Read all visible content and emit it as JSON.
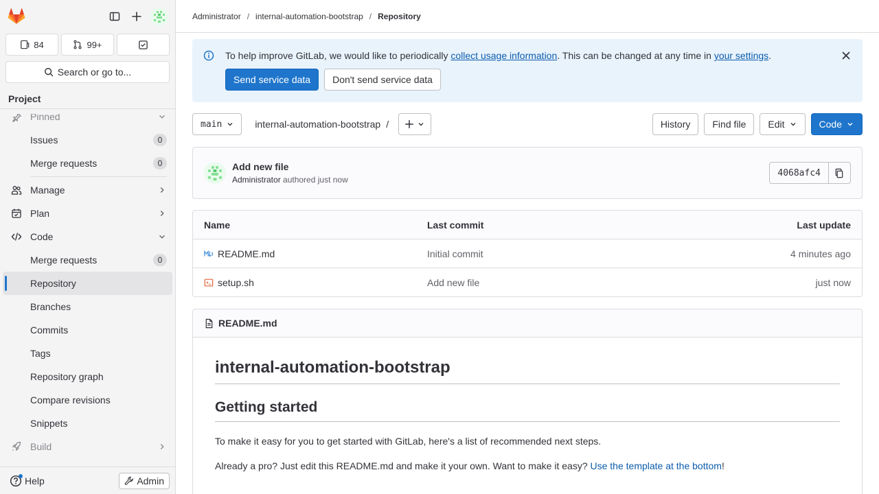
{
  "sidebar": {
    "counts": {
      "issues": "84",
      "merge_requests": "99+"
    },
    "search_label": "Search or go to...",
    "section_title": "Project",
    "pinned_label": "Pinned",
    "items": [
      {
        "label": "Issues",
        "badge": "0"
      },
      {
        "label": "Merge requests",
        "badge": "0"
      },
      {
        "label": "Manage"
      },
      {
        "label": "Plan"
      },
      {
        "label": "Code"
      },
      {
        "label": "Merge requests",
        "badge": "0"
      },
      {
        "label": "Repository"
      },
      {
        "label": "Branches"
      },
      {
        "label": "Commits"
      },
      {
        "label": "Tags"
      },
      {
        "label": "Repository graph"
      },
      {
        "label": "Compare revisions"
      },
      {
        "label": "Snippets"
      },
      {
        "label": "Build"
      }
    ],
    "help_label": "Help",
    "admin_label": "Admin"
  },
  "breadcrumb": [
    "Administrator",
    "internal-automation-bootstrap",
    "Repository"
  ],
  "banner": {
    "text_before": "To help improve GitLab, we would like to periodically ",
    "link1": "collect usage information",
    "text_mid": ". This can be changed at any time in ",
    "link2": "your settings",
    "text_after": ".",
    "primary_btn": "Send service data",
    "secondary_btn": "Don't send service data"
  },
  "toolbar": {
    "branch": "main",
    "path": "internal-automation-bootstrap",
    "slash": "/",
    "history": "History",
    "find_file": "Find file",
    "edit": "Edit",
    "code": "Code"
  },
  "commit": {
    "title": "Add new file",
    "author": "Administrator",
    "meta": "authored just now",
    "sha": "4068afc4"
  },
  "files": {
    "headers": [
      "Name",
      "Last commit",
      "Last update"
    ],
    "rows": [
      {
        "name": "README.md",
        "commit": "Initial commit",
        "updated": "4 minutes ago",
        "icon": "markdown-icon"
      },
      {
        "name": "setup.sh",
        "commit": "Add new file",
        "updated": "just now",
        "icon": "terminal-file-icon"
      }
    ]
  },
  "readme": {
    "filename": "README.md",
    "h1": "internal-automation-bootstrap",
    "h2": "Getting started",
    "p1": "To make it easy for you to get started with GitLab, here's a list of recommended next steps.",
    "p2_before": "Already a pro? Just edit this README.md and make it your own. Want to make it easy? ",
    "p2_link": "Use the template at the bottom",
    "p2_after": "!"
  },
  "colors": {
    "accent": "#1f75cb",
    "banner_bg": "#e9f3fc",
    "sidebar_bg": "#f4f4f5"
  }
}
